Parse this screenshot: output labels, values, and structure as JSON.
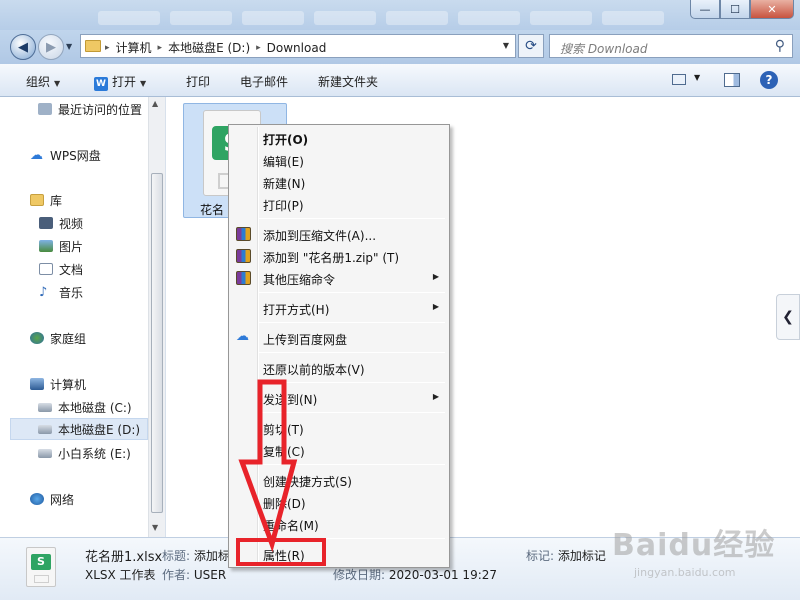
{
  "window": {
    "close_glyph": "✕",
    "minimize_glyph": "—",
    "maximize_glyph": "☐"
  },
  "navigation": {
    "back_glyph": "◀",
    "forward_glyph": "▶",
    "breadcrumb": [
      "计算机",
      "本地磁盘E (D:)",
      "Download"
    ],
    "separator_glyph": "▸",
    "search_placeholder": "搜索 Download"
  },
  "toolbar": {
    "organize_label": "组织",
    "open_label": "打开",
    "open_icon_letter": "W",
    "print_label": "打印",
    "email_label": "电子邮件",
    "new_folder_label": "新建文件夹",
    "help_label": "?"
  },
  "nav_pane": {
    "items": [
      {
        "label": "最近访问的位置",
        "icon": "recent-icon"
      },
      {
        "label": "WPS网盘",
        "icon": "cloud-icon"
      },
      {
        "label": "库",
        "icon": "library-icon"
      },
      {
        "label": "视频",
        "icon": "video-icon"
      },
      {
        "label": "图片",
        "icon": "picture-icon"
      },
      {
        "label": "文档",
        "icon": "document-icon"
      },
      {
        "label": "音乐",
        "icon": "music-icon"
      },
      {
        "label": "家庭组",
        "icon": "homegroup-icon"
      },
      {
        "label": "计算机",
        "icon": "computer-icon"
      },
      {
        "label": "本地磁盘 (C:)",
        "icon": "drive-icon"
      },
      {
        "label": "本地磁盘E (D:)",
        "icon": "drive-icon",
        "selected": true
      },
      {
        "label": "小白系统 (E:)",
        "icon": "drive-icon"
      },
      {
        "label": "网络",
        "icon": "network-icon"
      }
    ]
  },
  "content": {
    "file_name_visible": "花名",
    "file_icon_letter": "S"
  },
  "context_menu": {
    "items": [
      {
        "label": "打开(O)",
        "bold": true
      },
      {
        "label": "编辑(E)"
      },
      {
        "label": "新建(N)"
      },
      {
        "label": "打印(P)"
      },
      {
        "label": "添加到压缩文件(A)...",
        "icon": "winrar-icon"
      },
      {
        "label": "添加到 \"花名册1.zip\" (T)",
        "icon": "winrar-icon"
      },
      {
        "label": "其他压缩命令",
        "icon": "winrar-icon",
        "submenu": true
      },
      {
        "label": "打开方式(H)",
        "submenu": true
      },
      {
        "label": "上传到百度网盘",
        "icon": "baidu-cloud-icon"
      },
      {
        "label": "还原以前的版本(V)"
      },
      {
        "label": "发送到(N)",
        "submenu": true
      },
      {
        "label": "剪切(T)"
      },
      {
        "label": "复制(C)"
      },
      {
        "label": "创建快捷方式(S)"
      },
      {
        "label": "删除(D)"
      },
      {
        "label": "重命名(M)"
      },
      {
        "label": "属性(R)"
      }
    ]
  },
  "details": {
    "file_name": "花名册1.xlsx",
    "file_type": "XLSX 工作表",
    "title_label": "标题:",
    "title_value": "添加标",
    "author_label": "作者:",
    "author_value": "USER",
    "modified_label": "修改日期:",
    "modified_value": "2020-03-01 19:27",
    "tags_label": "标记:",
    "tags_value": "添加标记"
  },
  "annotation": {
    "color": "#e8232a",
    "target": "属性(R)"
  },
  "watermark": {
    "main": "Baidu经验",
    "sub": "jingyan.baidu.com"
  }
}
